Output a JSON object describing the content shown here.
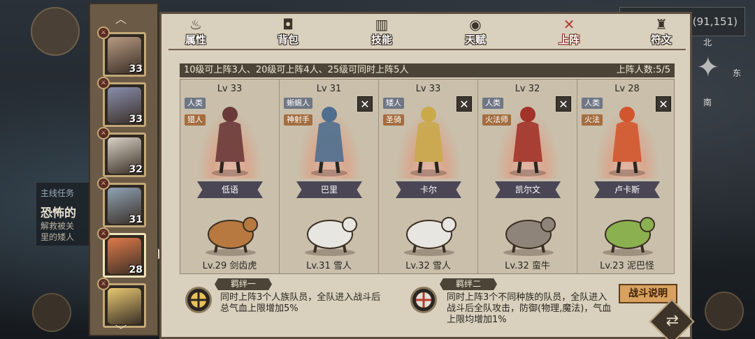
{
  "background": {
    "quest_title": "主线任务",
    "quest_name": "恐怖的",
    "quest_desc_1": "解救被关",
    "quest_desc_2": "里的矮人",
    "coords": "(91,151)",
    "compass": {
      "north": "北",
      "east": "东",
      "south": "南"
    }
  },
  "roster": [
    {
      "level": "33",
      "face_color": "#b79a82",
      "active": false
    },
    {
      "level": "33",
      "face_color": "#8a8fb0",
      "active": false
    },
    {
      "level": "32",
      "face_color": "#d9d2c7",
      "active": false
    },
    {
      "level": "31",
      "face_color": "#8fa3b5",
      "active": false
    },
    {
      "level": "28",
      "face_color": "#e07a4a",
      "active": true
    },
    {
      "level": "",
      "face_color": "#e8c872",
      "active": false
    }
  ],
  "tabs": [
    {
      "label": "属性",
      "icon": "flame-icon"
    },
    {
      "label": "背包",
      "icon": "bag-icon"
    },
    {
      "label": "技能",
      "icon": "book-icon"
    },
    {
      "label": "天赋",
      "icon": "eye-icon"
    },
    {
      "label": "上阵",
      "icon": "crossed-swords-icon",
      "active": true
    },
    {
      "label": "符文",
      "icon": "rune-icon"
    }
  ],
  "info_bar": {
    "rule": "10级可上阵3人、20级可上阵4人、25级可同时上阵5人",
    "count": "上阵人数:5/5"
  },
  "slots": [
    {
      "level": "Lv 33",
      "race": "人类",
      "cls": "猎人",
      "name": "低语",
      "pet": "Lv.29 剑齿虎",
      "closable": false
    },
    {
      "level": "Lv 31",
      "race": "蜥蜴人",
      "cls": "神射手",
      "name": "巴里",
      "pet": "Lv.31 雪人",
      "closable": true
    },
    {
      "level": "Lv 33",
      "race": "矮人",
      "cls": "圣骑",
      "name": "卡尔",
      "pet": "Lv.32 雪人",
      "closable": true
    },
    {
      "level": "Lv 32",
      "race": "人类",
      "cls": "火法师",
      "name": "凯尔文",
      "pet": "Lv.32 蛮牛",
      "closable": true
    },
    {
      "level": "Lv 28",
      "race": "人类",
      "cls": "火法",
      "name": "卢卡斯",
      "pet": "Lv.23 泥巴怪",
      "closable": true
    }
  ],
  "bonds": [
    {
      "title": "羁绊一",
      "desc_1": "同时上阵3个人族队员，全队进入战斗后",
      "desc_2": "总气血上限增加5%"
    },
    {
      "title": "羁绊二",
      "desc_1": "同时上阵3个不同种族的队员，全队进入",
      "desc_2": "战斗后全队攻击，防御(物理,魔法)，气血",
      "desc_3": "上限均增加1%"
    }
  ],
  "buttons": {
    "battle_help": "战斗说明",
    "close_glyph": "✕"
  },
  "colors": {
    "panel_bg": "#d9d0bd",
    "active_tab": "#b53a2f",
    "roster_bg": "#6b5a45"
  }
}
